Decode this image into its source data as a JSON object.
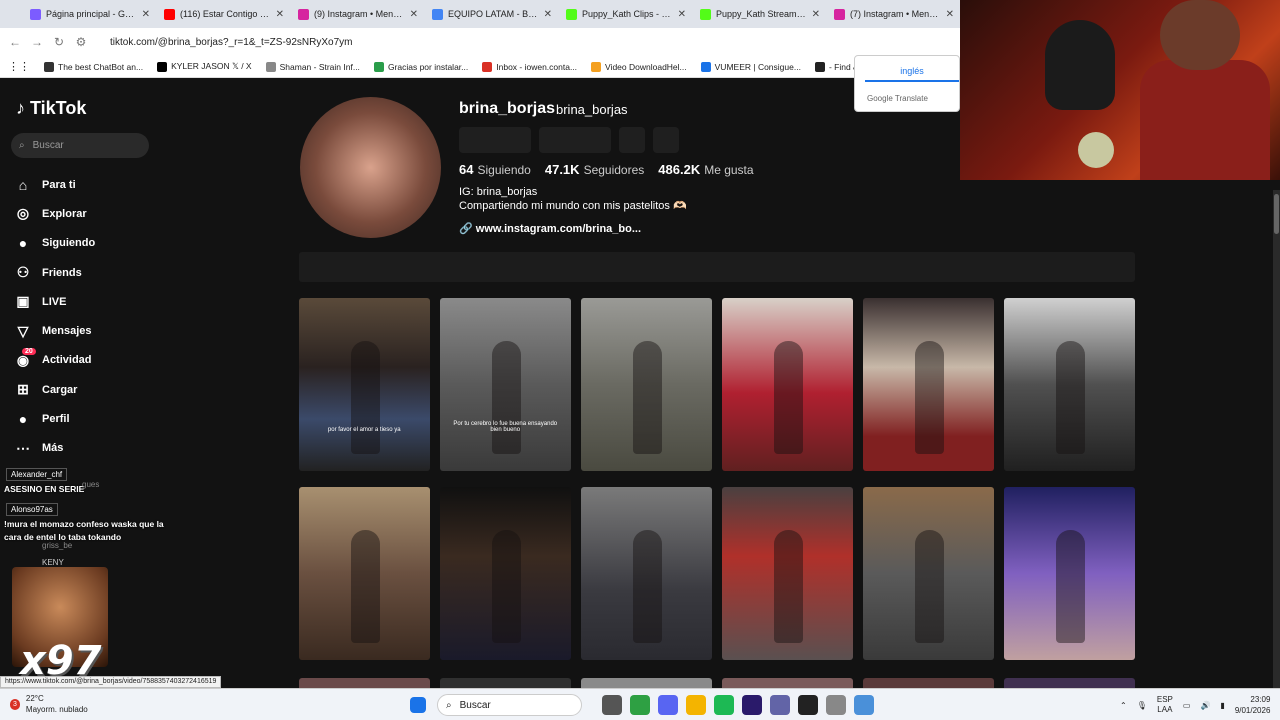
{
  "browser": {
    "tabs": [
      {
        "title": "Página principal - Google",
        "color": "#7c5cff"
      },
      {
        "title": "(116) Estar Contigo - You",
        "color": "#ff0000"
      },
      {
        "title": "(9) Instagram • Mensajes",
        "color": "#d6249f"
      },
      {
        "title": "EQUIPO LATAM - Buscar c",
        "color": "#4285f4"
      },
      {
        "title": "Puppy_Kath Clips - Watch",
        "color": "#53fc18"
      },
      {
        "title": "Puppy_Kath Stream - Wat",
        "color": "#53fc18"
      },
      {
        "title": "(7) Instagram • Mensajes",
        "color": "#d6249f"
      }
    ],
    "url": "tiktok.com/@brina_borjas?_r=1&_t=ZS-92sNRyXo7ym",
    "bookmarks": [
      {
        "label": "The best ChatBot an...",
        "color": "#333"
      },
      {
        "label": "KYLER JASON 𝕏 / X",
        "color": "#000"
      },
      {
        "label": "Shaman - Strain Inf...",
        "color": "#888"
      },
      {
        "label": "Gracias por instalar...",
        "color": "#2a9d4a"
      },
      {
        "label": "Inbox - iowen.conta...",
        "color": "#d93025"
      },
      {
        "label": "Video DownloadHel...",
        "color": "#f4a020"
      },
      {
        "label": "VUMEER | Consigue...",
        "color": "#1a73e8"
      },
      {
        "label": "- Find & Share on G...",
        "color": "#222"
      }
    ]
  },
  "translate_popup": {
    "language": "inglés",
    "brand": "Google Translate"
  },
  "tiktok": {
    "brand": "TikTok",
    "search_placeholder": "Buscar",
    "menu": [
      {
        "label": "Para ti",
        "icon": "home-icon"
      },
      {
        "label": "Explorar",
        "icon": "compass-icon"
      },
      {
        "label": "Siguiendo",
        "icon": "following-avatar-icon"
      },
      {
        "label": "Friends",
        "icon": "friends-icon"
      },
      {
        "label": "LIVE",
        "icon": "live-icon"
      },
      {
        "label": "Mensajes",
        "icon": "messages-icon"
      },
      {
        "label": "Actividad",
        "icon": "activity-icon",
        "badge": "20"
      },
      {
        "label": "Cargar",
        "icon": "upload-icon"
      },
      {
        "label": "Perfil",
        "icon": "profile-avatar-icon"
      },
      {
        "label": "Más",
        "icon": "more-icon"
      }
    ],
    "profile": {
      "username": "brina_borjas",
      "nickname": "brina_borjas",
      "following_count": "64",
      "following_label": "Siguiendo",
      "followers_count": "47.1K",
      "followers_label": "Seguidores",
      "likes_count": "486.2K",
      "likes_label": "Me gusta",
      "bio_line1": "IG: brina_borjas",
      "bio_line2": "Compartiendo mi mundo con mis pastelitos 🫶🏻",
      "link": "www.instagram.com/brina_bo..."
    },
    "videos": [
      {
        "bg": "linear-gradient(180deg,#5a4a3a,#2a2220 40%,#3b4a6a 70%,#222)",
        "caption": "por favor el amor a tieso ya"
      },
      {
        "bg": "linear-gradient(180deg,#8a8a8a,#5a5a5a 50%,#3a3a3a)",
        "caption": "Por tu cerebro lo fue buena ensayando bien bueno"
      },
      {
        "bg": "linear-gradient(180deg,#9a9a96,#6a6a62 50%,#4a4a40)",
        "caption": ""
      },
      {
        "bg": "linear-gradient(180deg,#d8d0c8,#b02030 55%,#602020)",
        "caption": ""
      },
      {
        "bg": "linear-gradient(180deg,#3a3030,#c8b8a8 40%,#802020 80%)",
        "caption": ""
      },
      {
        "bg": "linear-gradient(180deg,#d0d0d0,#505050 50%,#202020)",
        "caption": ""
      },
      {
        "bg": "linear-gradient(180deg,#a89070,#6a5040 50%,#3a2a20)",
        "caption": ""
      },
      {
        "bg": "linear-gradient(180deg,#101010,#3a2a20 40%,#1a1a2a)",
        "caption": ""
      },
      {
        "bg": "linear-gradient(180deg,#7a7a7a,#3a3a40 60%,#2a2a30)",
        "caption": ""
      },
      {
        "bg": "linear-gradient(180deg,#4a4040,#b0302a 40%,#5a5050)",
        "caption": ""
      },
      {
        "bg": "linear-gradient(180deg,#8a6a4a,#5a5a5a 50%,#3a3a3a)",
        "caption": ""
      },
      {
        "bg": "linear-gradient(180deg,#202060,#8060c0 50%,#c0a0a0)",
        "caption": ""
      }
    ],
    "row3_colors": [
      "#6a4a4a",
      "#303030",
      "#8a8a8a",
      "#7a5a5a",
      "#5a3a3a",
      "#403050"
    ]
  },
  "stream_overlay": {
    "chat": [
      {
        "user": "Alexander_chf",
        "user_color": "#9ef0a0",
        "message": "ASESINO EN SERIE"
      },
      {
        "user": "Alonso97as",
        "user_color": "#ff8080",
        "message": "!mura el momazo confeso waska que la cara de entel lo taba tokando"
      }
    ],
    "emote_count": "x97",
    "faded_names": [
      "gues",
      "griss_be",
      "KENY"
    ]
  },
  "status_url": "https://www.tiktok.com/@brina_borjas/video/7588357403272416519",
  "taskbar": {
    "temperature": "22°C",
    "weather": "Mayorm. nublado",
    "weather_badge": "3",
    "search": "Buscar",
    "lang1": "ESP",
    "lang2": "LAA",
    "time": "23:09",
    "date": "9/01/2026",
    "app_colors": [
      "#1a73e8",
      "#555",
      "#2ea043",
      "#5865f2",
      "#f4b400",
      "#1db954",
      "#2a1a6a",
      "#6264a7",
      "#222",
      "#888",
      "#4a90d9"
    ]
  }
}
